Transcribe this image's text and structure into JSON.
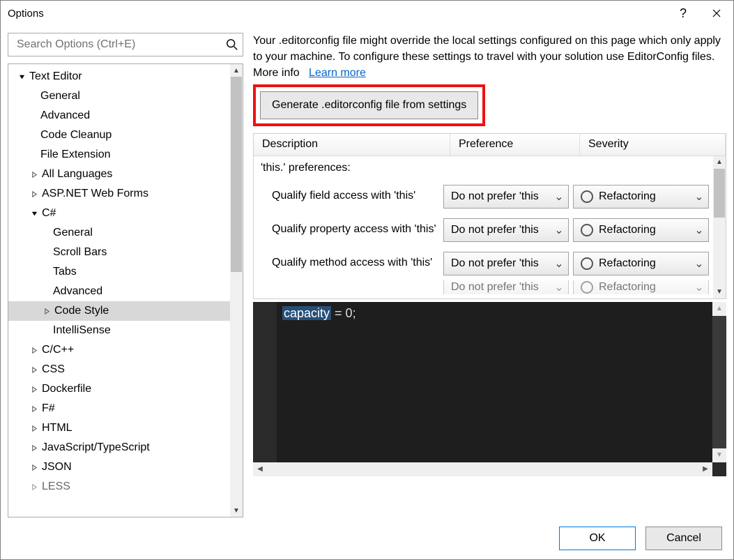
{
  "window": {
    "title": "Options"
  },
  "search": {
    "placeholder": "Search Options (Ctrl+E)"
  },
  "tree": {
    "root_label": "Text Editor",
    "items_a": [
      {
        "label": "General"
      },
      {
        "label": "Advanced"
      },
      {
        "label": "Code Cleanup"
      },
      {
        "label": "File Extension"
      }
    ],
    "items_b": [
      {
        "label": "All Languages",
        "exp": "closed"
      },
      {
        "label": "ASP.NET Web Forms",
        "exp": "closed"
      }
    ],
    "csharp": {
      "label": "C#",
      "children_a": [
        {
          "label": "General"
        },
        {
          "label": "Scroll Bars"
        },
        {
          "label": "Tabs"
        },
        {
          "label": "Advanced"
        }
      ],
      "code_style": {
        "label": "Code Style"
      },
      "intellisense": {
        "label": "IntelliSense"
      }
    },
    "items_c": [
      {
        "label": "C/C++",
        "exp": "closed"
      },
      {
        "label": "CSS",
        "exp": "closed"
      },
      {
        "label": "Dockerfile",
        "exp": "closed"
      },
      {
        "label": "F#",
        "exp": "closed"
      },
      {
        "label": "HTML",
        "exp": "closed"
      },
      {
        "label": "JavaScript/TypeScript",
        "exp": "closed"
      },
      {
        "label": "JSON",
        "exp": "closed"
      },
      {
        "label": "LESS",
        "exp": "closed"
      }
    ]
  },
  "info": {
    "text": "Your .editorconfig file might override the local settings configured on this page which only apply to your machine. To configure these settings to travel with your solution use EditorConfig files. More info",
    "link": "Learn more"
  },
  "generate_button": "Generate .editorconfig file from settings",
  "table": {
    "headers": {
      "desc": "Description",
      "pref": "Preference",
      "sev": "Severity"
    },
    "group": "'this.' preferences:",
    "rows": [
      {
        "desc": "Qualify field access with 'this'",
        "pref": "Do not prefer 'this",
        "sev": "Refactoring"
      },
      {
        "desc": "Qualify property access with 'this'",
        "pref": "Do not prefer 'this",
        "sev": "Refactoring"
      },
      {
        "desc": "Qualify method access with 'this'",
        "pref": "Do not prefer 'this",
        "sev": "Refactoring"
      },
      {
        "desc": "",
        "pref": "Do not prefer 'this",
        "sev": "Refactoring"
      }
    ]
  },
  "code": {
    "line1_hl": "capacity",
    "line1_rest": " = 0;"
  },
  "footer": {
    "ok": "OK",
    "cancel": "Cancel"
  }
}
